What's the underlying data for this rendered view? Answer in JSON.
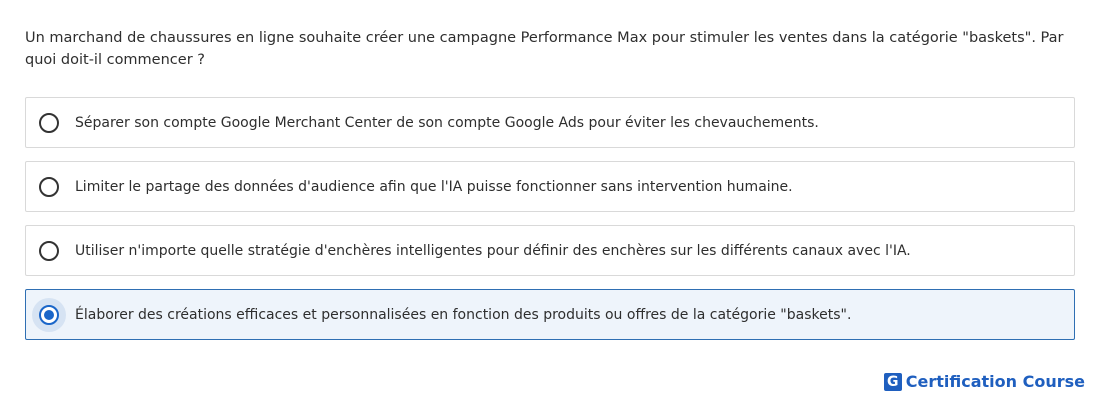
{
  "question": {
    "text": "Un marchand de chaussures en ligne souhaite créer une campagne Performance Max pour stimuler les ventes dans la catégorie \"baskets\". Par quoi doit-il commencer ?"
  },
  "options": [
    {
      "label": "Séparer son compte Google Merchant Center de son compte Google Ads pour éviter les chevauchements.",
      "selected": false
    },
    {
      "label": "Limiter le partage des données d'audience afin que l'IA puisse fonctionner sans intervention humaine.",
      "selected": false
    },
    {
      "label": "Utiliser n'importe quelle stratégie d'enchères intelligentes pour définir des enchères sur les différents canaux avec l'IA.",
      "selected": false
    },
    {
      "label": "Élaborer des créations efficaces et personnalisées en fonction des produits ou offres de la catégorie \"baskets\".",
      "selected": true
    }
  ],
  "brand": {
    "logo_letter": "G",
    "name": "Certification Course"
  },
  "colors": {
    "accent": "#1a66c9",
    "selected_border": "#2f6fb3",
    "selected_background": "#eef4fb",
    "brand": "#1f5fbf"
  }
}
